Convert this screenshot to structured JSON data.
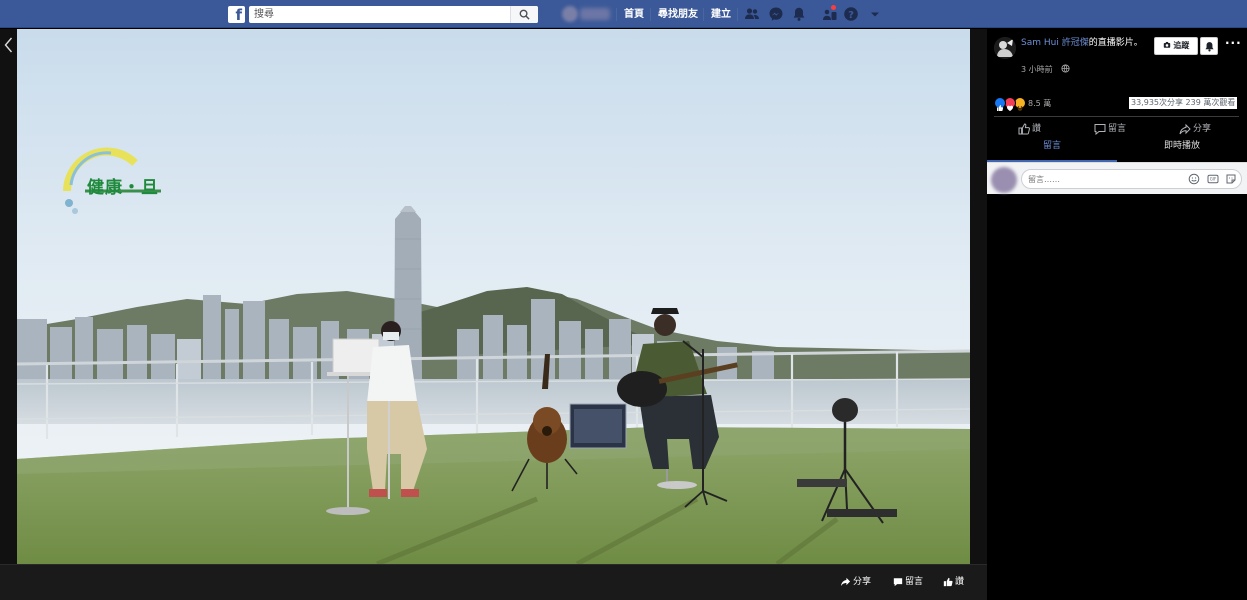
{
  "topbar": {
    "logo_letter": "f",
    "search_placeholder": "搜尋",
    "nav_links": [
      "首頁",
      "尋找朋友",
      "建立"
    ]
  },
  "video": {
    "overlay_logo_text": "健康・旦",
    "actions": {
      "share": "分享",
      "comment": "留言",
      "like": "讚"
    }
  },
  "panel": {
    "author_name": "Sam Hui 許冠傑",
    "title_suffix": "的直播影片。",
    "time": "3 小時前",
    "follow_label": "追蹤",
    "reaction_count": "8.5 萬",
    "stats": "33,935次分享  239 萬次觀看",
    "actions": {
      "like": "讚",
      "comment": "留言",
      "share": "分享"
    },
    "tabs": [
      "留言",
      "即時播放"
    ],
    "comment_placeholder": "留言……"
  },
  "colors": {
    "topbar": "#3b5998",
    "link": "#6d8fd6",
    "panel_bg": "#000000",
    "like_blue": "#1877f2",
    "love_red": "#f33e58",
    "haha_yellow": "#f7b125"
  },
  "icons": [
    "facebook-logo-icon",
    "search-icon",
    "friend-requests-icon",
    "messenger-icon",
    "notifications-icon",
    "quick-help-icon",
    "account-menu-icon",
    "back-chevron-icon",
    "share-icon",
    "comment-icon",
    "like-icon",
    "globe-icon",
    "bell-icon",
    "more-icon",
    "emoji-icon",
    "gif-icon",
    "sticker-icon"
  ]
}
